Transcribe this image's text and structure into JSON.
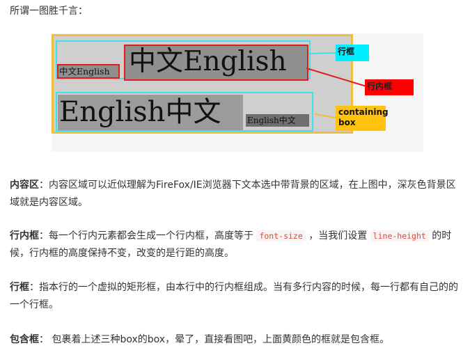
{
  "intro": "所谓一图胜千言：",
  "diagram": {
    "line1_small": "中文English",
    "line1_big": "中文English",
    "line2_big": "English中文",
    "line2_small": "English中文",
    "labels": {
      "line_box": "行框",
      "inline_box": "行内框",
      "containing_box_1": "containing",
      "containing_box_2": "box"
    },
    "colors": {
      "containing_border": "#f0bd3e",
      "line_box_border": "#3fe0e8",
      "inline_box_border": "#e21c1c",
      "content_area": "#9b9b9b"
    }
  },
  "paragraphs": {
    "content_area": {
      "term": "内容区",
      "sep": "：",
      "text": "内容区域可以近似理解为FireFox/IE浏览器下文本选中带背景的区域，在上图中，深灰色背景区域就是内容区域。"
    },
    "inline_box": {
      "term": "行内框",
      "sep": "：",
      "text_a": "每一个行内元素都会生成一个行内框，高度等于",
      "code1": "font-size",
      "text_b": "，当我们设置",
      "code2": "line-height",
      "text_c": "的时候，行内框的高度保持不变，改变的是行距的高度。"
    },
    "line_box": {
      "term": "行框",
      "sep": "：",
      "text": "指本行的一个虚拟的矩形框，由本行中的行内框组成。当有多行内容的时候，每一行都有自己的的一个行框。"
    },
    "containing_box": {
      "term": "包含框",
      "sep": "：",
      "text": " 包裹着上述三种box的box，晕了，直接看图吧，上面黄颜色的框就是包含框。"
    }
  }
}
